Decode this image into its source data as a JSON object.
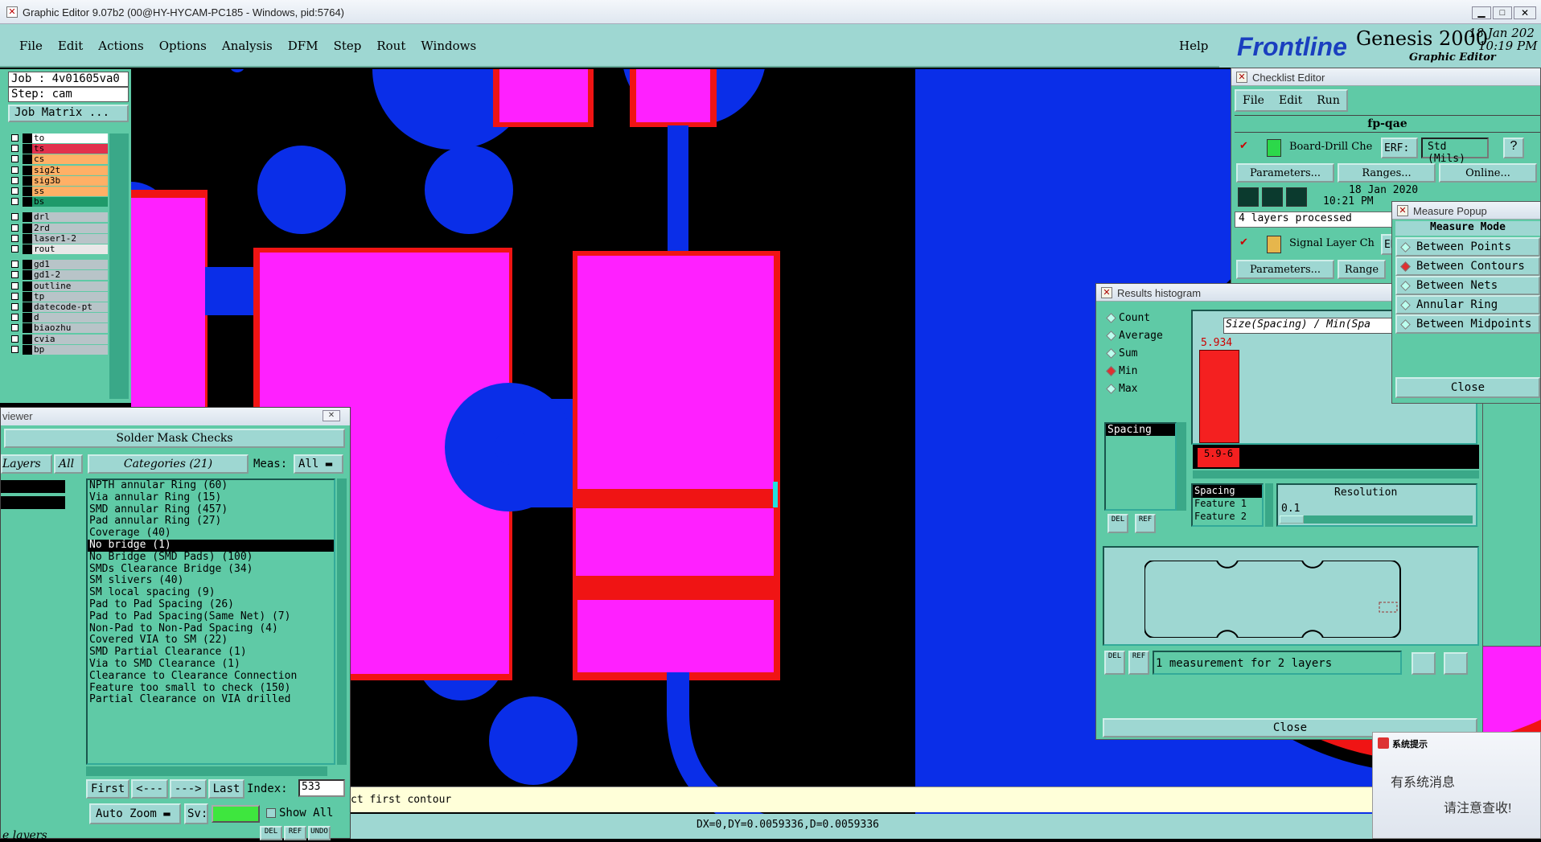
{
  "title_bar": {
    "title": "Graphic Editor 9.07b2 (00@HY-HYCAM-PC185 - Windows, pid:5764)"
  },
  "menu": {
    "items": [
      "File",
      "Edit",
      "Actions",
      "Options",
      "Analysis",
      "DFM",
      "Step",
      "Rout",
      "Windows"
    ],
    "help": "Help"
  },
  "brand": {
    "logo": "Frontline",
    "product": "Genesis 2000",
    "sub": "Graphic Editor",
    "date": "18 Jan 202",
    "time": "10:19 PM"
  },
  "job": {
    "job": "Job : 4v01605va0",
    "step": "Step: cam",
    "matrix": "Job Matrix ..."
  },
  "layers": [
    {
      "name": "to",
      "color": "#ffffff"
    },
    {
      "name": "ts",
      "color": "#e2314d"
    },
    {
      "name": "cs",
      "color": "#ffb066"
    },
    {
      "name": "sig2t",
      "color": "#ffb066"
    },
    {
      "name": "sig3b",
      "color": "#ffb066"
    },
    {
      "name": "ss",
      "color": "#ffb066"
    },
    {
      "name": "bs",
      "color": "#1e9a6a"
    },
    {
      "name": "drl",
      "color": "#b8c4c8"
    },
    {
      "name": "2rd",
      "color": "#b8c4c8"
    },
    {
      "name": "laser1-2",
      "color": "#b8c4c8"
    },
    {
      "name": "rout",
      "color": "#e8e8e8"
    },
    {
      "name": "gd1",
      "color": "#b8c4c8"
    },
    {
      "name": "gd1-2",
      "color": "#b8c4c8"
    },
    {
      "name": "outline",
      "color": "#b8c4c8"
    },
    {
      "name": "tp",
      "color": "#b8c4c8"
    },
    {
      "name": "datecode-pt",
      "color": "#b8c4c8"
    },
    {
      "name": "d",
      "color": "#b8c4c8"
    },
    {
      "name": "biaozhu",
      "color": "#b8c4c8"
    },
    {
      "name": "cvia",
      "color": "#b8c4c8"
    },
    {
      "name": "bp",
      "color": "#b8c4c8"
    }
  ],
  "viewer": {
    "title": "viewer",
    "header": "Solder Mask Checks",
    "layers_label": "Layers",
    "all1": "All",
    "categories_label": "Categories (21)",
    "meas_label": "Meas:",
    "meas_value": "All",
    "categories": [
      "NPTH annular Ring (60)",
      "Via annular Ring (15)",
      "SMD annular Ring (457)",
      "Pad annular Ring (27)",
      "Coverage (40)",
      "No bridge (1)",
      "No Bridge (SMD Pads) (100)",
      "SMDs Clearance Bridge (34)",
      "SM slivers (40)",
      "SM local spacing (9)",
      "Pad to Pad Spacing (26)",
      "Pad to Pad Spacing(Same Net) (7)",
      "Non-Pad to Non-Pad Spacing (4)",
      "Covered VIA to SM (22)",
      "SMD Partial Clearance (1)",
      "Via to SMD Clearance (1)",
      "Clearance to Clearance Connection",
      "Feature too small to check (150)",
      "Partial Clearance on VIA drilled"
    ],
    "selected_index": 5,
    "nav": [
      "First",
      "<---",
      "--->",
      "Last"
    ],
    "index_label": "Index:",
    "index_value": "533",
    "zoom": "Auto Zoom",
    "sv": "Sv:",
    "show_all": "Show All",
    "footer": "e layers",
    "small_btns": [
      "DEL",
      "REF",
      "UNDO"
    ]
  },
  "prompt": {
    "text": "ct first contour"
  },
  "status": {
    "text": "DX=0,DY=0.0059336,D=0.0059336"
  },
  "checklist": {
    "title": "Checklist Editor",
    "menu": [
      "File",
      "Edit",
      "Run"
    ],
    "name": "fp-qae",
    "item1": "Board-Drill Che",
    "erf": "ERF:",
    "std": "Std (Mils)",
    "q": "?",
    "params": "Parameters...",
    "ranges": "Ranges...",
    "online": "Online...",
    "date": "18 Jan 2020",
    "time": "10:21 PM",
    "processed": "4 layers processed",
    "item2": "Signal Layer Ch",
    "erf2": "ER",
    "params2": "Parameters...",
    "ranges2": "Range"
  },
  "histogram": {
    "title": "Results histogram",
    "options": [
      "Count",
      "Average",
      "Sum",
      "Min",
      "Max"
    ],
    "selected": "Min",
    "list_item": "Spacing",
    "graph_title": "Size(Spacing) / Min(Spa",
    "bar_value": "5.934",
    "bar_label": "5.9-6",
    "spacing_list": [
      "Spacing",
      "Feature 1",
      "Feature 2"
    ],
    "resolution_label": "Resolution",
    "resolution_value": "0.1",
    "measurement": "1 measurement for 2 layers",
    "close": "Close",
    "del": "DEL",
    "ref": "REF"
  },
  "measure": {
    "title": "Measure Popup",
    "mode": "Measure Mode",
    "options": [
      "Between Points",
      "Between Contours",
      "Between Nets",
      "Annular Ring",
      "Between Midpoints"
    ],
    "selected": "Between Contours",
    "close": "Close"
  },
  "notify": {
    "title": "系统提示",
    "line1": "有系统消息",
    "line2": "请注意查收!"
  }
}
